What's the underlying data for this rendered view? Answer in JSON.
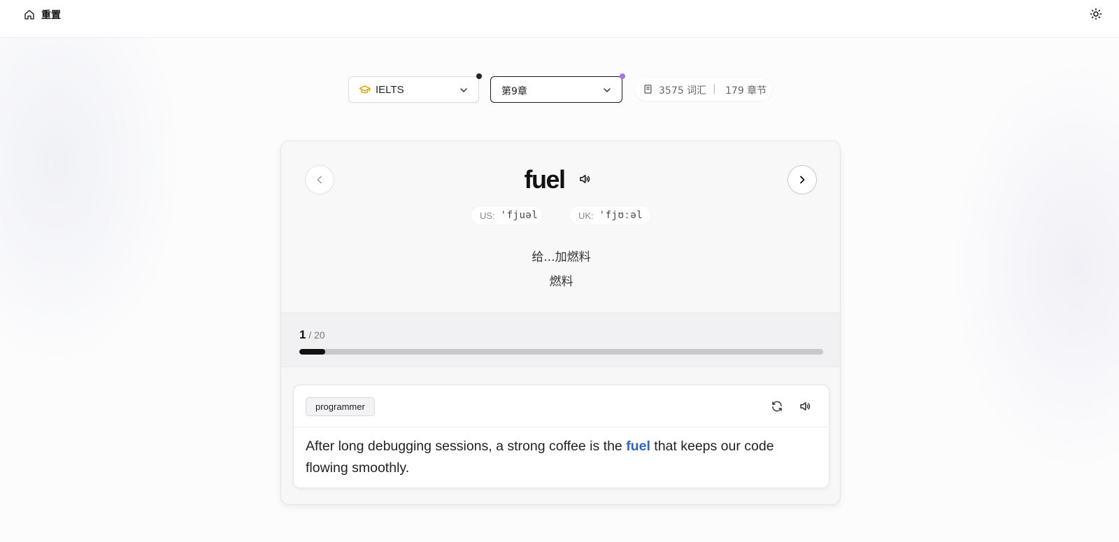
{
  "header": {
    "home_label": "重置",
    "home_icon": "home-icon",
    "theme_icon": "sun-icon"
  },
  "selectors": {
    "book": {
      "value": "IELTS",
      "icon": "graduation-cap-icon",
      "indicator_color": "#222222"
    },
    "chapter": {
      "value": "第9章",
      "indicator_color": "#a576e8"
    }
  },
  "stats": {
    "words": "3575 词汇",
    "separator": "|",
    "chapters": "179 章节"
  },
  "word_card": {
    "word": "fuel",
    "us_tag": "US:",
    "us_ipa": "'fjuəl",
    "uk_tag": "UK:",
    "uk_ipa": "'fjʊːəl",
    "meanings": [
      "给...加燃料",
      "燃料"
    ]
  },
  "progress": {
    "current": "1",
    "total_text": "/ 20",
    "fraction": 0.05
  },
  "example": {
    "persona": "programmer",
    "sentence_before": "After long debugging sessions, a strong coffee is the ",
    "highlight": "fuel",
    "sentence_after": " that keeps our code flowing smoothly.",
    "highlight_color": "#2c64c8"
  }
}
